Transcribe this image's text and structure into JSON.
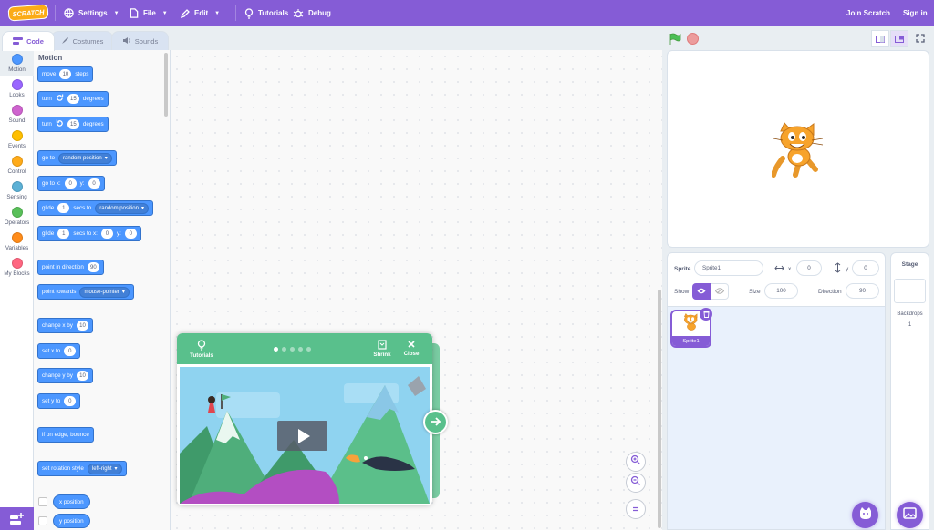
{
  "menu": {
    "logo": "SCRATCH",
    "settings": "Settings",
    "file": "File",
    "edit": "Edit",
    "tutorials": "Tutorials",
    "debug": "Debug",
    "join": "Join Scratch",
    "signin": "Sign in"
  },
  "tabs": {
    "code": "Code",
    "costumes": "Costumes",
    "sounds": "Sounds"
  },
  "categories": [
    {
      "label": "Motion",
      "color": "#4c97ff"
    },
    {
      "label": "Looks",
      "color": "#9966ff"
    },
    {
      "label": "Sound",
      "color": "#cf63cf"
    },
    {
      "label": "Events",
      "color": "#ffbf00"
    },
    {
      "label": "Control",
      "color": "#ffab19"
    },
    {
      "label": "Sensing",
      "color": "#5cb1d6"
    },
    {
      "label": "Operators",
      "color": "#59c059"
    },
    {
      "label": "Variables",
      "color": "#ff8c1a"
    },
    {
      "label": "My Blocks",
      "color": "#ff6680"
    }
  ],
  "palette": {
    "heading": "Motion",
    "move": {
      "a": "move",
      "n": "10",
      "b": "steps"
    },
    "turn_right": {
      "a": "turn",
      "n": "15",
      "b": "degrees"
    },
    "turn_left": {
      "a": "turn",
      "n": "15",
      "b": "degrees"
    },
    "goto": {
      "a": "go to",
      "dd": "random position"
    },
    "gotoxy": {
      "a": "go to x:",
      "x": "0",
      "b": "y:",
      "y": "0"
    },
    "glide_to": {
      "a": "glide",
      "n": "1",
      "b": "secs to",
      "dd": "random position"
    },
    "glide_xy": {
      "a": "glide",
      "n": "1",
      "b": "secs to x:",
      "x": "0",
      "c": "y:",
      "y": "0"
    },
    "point_dir": {
      "a": "point in direction",
      "n": "90"
    },
    "point_towards": {
      "a": "point towards",
      "dd": "mouse-pointer"
    },
    "change_x": {
      "a": "change x by",
      "n": "10"
    },
    "set_x": {
      "a": "set x to",
      "n": "0"
    },
    "change_y": {
      "a": "change y by",
      "n": "10"
    },
    "set_y": {
      "a": "set y to",
      "n": "0"
    },
    "bounce": {
      "a": "if on edge, bounce"
    },
    "rotation": {
      "a": "set rotation style",
      "dd": "left-right"
    },
    "x_position": "x position",
    "y_position": "y position"
  },
  "tutorial": {
    "tutorials": "Tutorials",
    "shrink": "Shrink",
    "close": "Close",
    "step_index": 0,
    "step_count": 5
  },
  "sprite_info": {
    "sprite_label": "Sprite",
    "sprite_name": "Sprite1",
    "x_label": "x",
    "x_value": "0",
    "y_label": "y",
    "y_value": "0",
    "show_label": "Show",
    "size_label": "Size",
    "size_value": "100",
    "direction_label": "Direction",
    "direction_value": "90"
  },
  "sprites": [
    {
      "name": "Sprite1"
    }
  ],
  "stage_panel": {
    "title": "Stage",
    "backdrops_label": "Backdrops",
    "backdrops_count": "1"
  },
  "colors": {
    "accent": "#855cd6",
    "motion": "#4c97ff",
    "tutorial": "#59c08c"
  }
}
